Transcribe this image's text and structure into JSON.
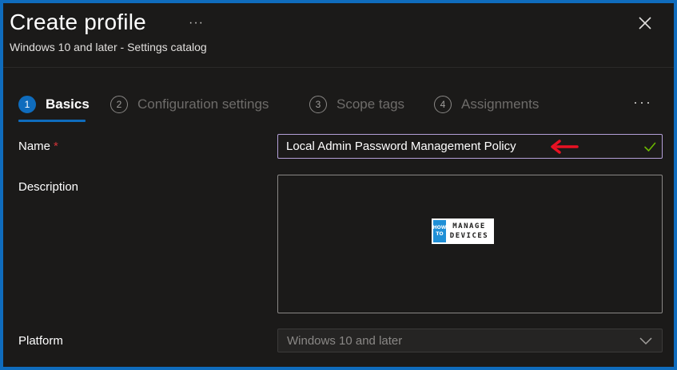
{
  "header": {
    "title": "Create profile",
    "more": "···",
    "subtitle": "Windows 10 and later - Settings catalog",
    "close_icon": "close-icon"
  },
  "steps": [
    {
      "number": "1",
      "label": "Basics",
      "active": true
    },
    {
      "number": "2",
      "label": "Configuration settings",
      "active": false
    },
    {
      "number": "3",
      "label": "Scope tags",
      "active": false
    },
    {
      "number": "4",
      "label": "Assignments",
      "active": false
    }
  ],
  "steps_more": "···",
  "form": {
    "name_label": "Name",
    "required_mark": "*",
    "name_value": "Local Admin Password Management Policy",
    "description_label": "Description",
    "description_value": "",
    "platform_label": "Platform",
    "platform_value": "Windows 10 and later"
  },
  "watermark": {
    "how": "HOW",
    "to": "TO",
    "line1": "MANAGE",
    "line2": "DEVICES"
  },
  "colors": {
    "accent": "#0f6cbd",
    "background": "#1b1a19",
    "required": "#d13438",
    "valid_check": "#6bb700",
    "annotation_arrow": "#e81123"
  }
}
